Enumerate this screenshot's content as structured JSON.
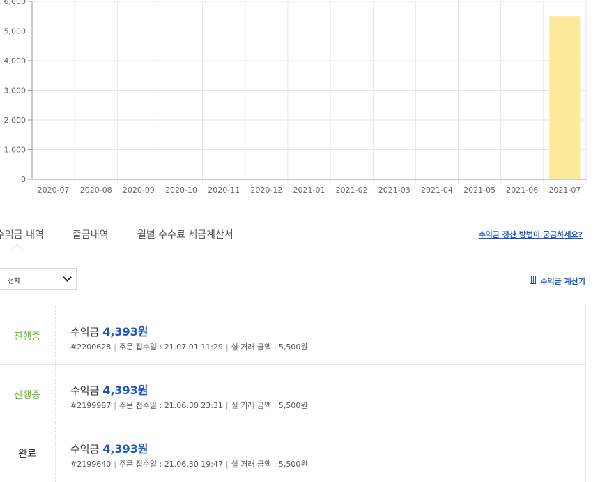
{
  "chart_data": {
    "type": "bar",
    "categories": [
      "2020-07",
      "2020-08",
      "2020-09",
      "2020-10",
      "2020-11",
      "2020-12",
      "2021-01",
      "2021-02",
      "2021-03",
      "2021-04",
      "2021-05",
      "2021-06",
      "2021-07"
    ],
    "values": [
      0,
      0,
      0,
      0,
      0,
      0,
      0,
      0,
      0,
      0,
      0,
      0,
      5500
    ],
    "yticks": [
      "0",
      "1,000",
      "2,000",
      "3,000",
      "4,000",
      "5,000",
      "6,000"
    ],
    "ylim": [
      0,
      6000
    ],
    "grid": true,
    "bar_color": "#fde99a"
  },
  "tabs": [
    {
      "label": "수익금 내역",
      "active": true
    },
    {
      "label": "출금내역",
      "active": false
    },
    {
      "label": "월별 수수료 세금계산서",
      "active": false
    }
  ],
  "help_link": "수익금 정산 방법이 궁금하세요?",
  "filter": {
    "selected": "전체"
  },
  "calculator_link": "수익금 계산기",
  "records": [
    {
      "status": "진행중",
      "status_type": "progress",
      "amount_label": "수익금",
      "amount": "4,393원",
      "order_no": "#2200628",
      "received": "주문 접수일 : 21.07.01 11:29",
      "deal_amount": "실 거래 금액 : 5,500원"
    },
    {
      "status": "진행중",
      "status_type": "progress",
      "amount_label": "수익금",
      "amount": "4,393원",
      "order_no": "#2199987",
      "received": "주문 접수일 : 21.06.30 23:31",
      "deal_amount": "실 거래 금액 : 5,500원"
    },
    {
      "status": "완료",
      "status_type": "done",
      "amount_label": "수익금",
      "amount": "4,393원",
      "order_no": "#2199640",
      "received": "주문 접수일 : 21.06.30 19:47",
      "deal_amount": "실 거래 금액 : 5,500원"
    }
  ],
  "colors": {
    "accent": "#1a55c8",
    "progress": "#66b92e",
    "bar": "#fde99a"
  }
}
